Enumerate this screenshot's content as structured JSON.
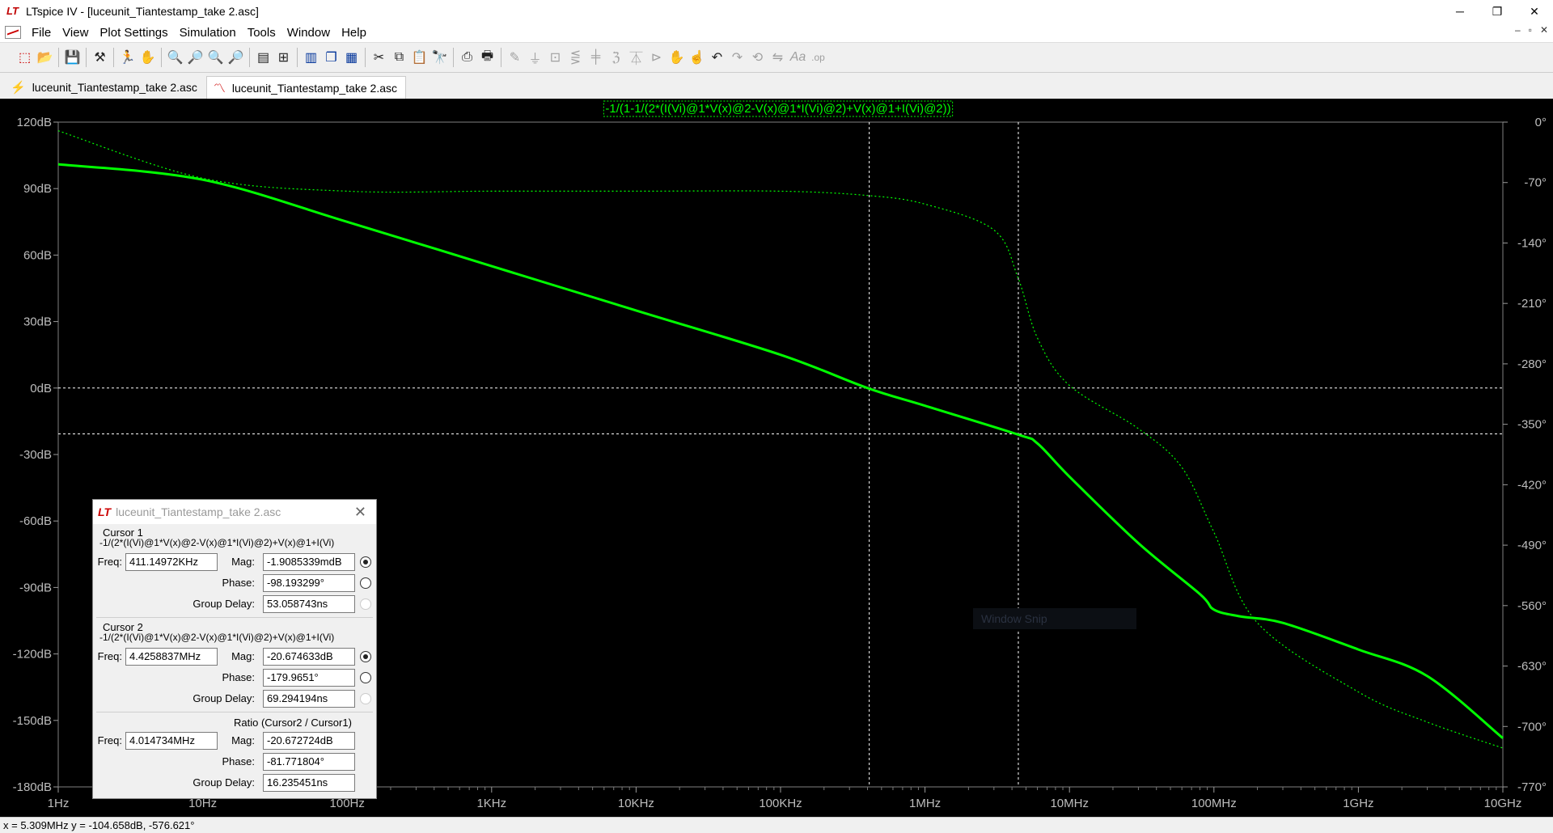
{
  "window": {
    "title": "LTspice IV - [luceunit_Tiantestamp_take 2.asc]",
    "app_icon_text": "LT",
    "controls": [
      "─",
      "❐",
      "✕"
    ]
  },
  "menu": {
    "items": [
      "File",
      "View",
      "Plot Settings",
      "Simulation",
      "Tools",
      "Window",
      "Help"
    ],
    "mdi_controls": [
      "–",
      "▫",
      "✕"
    ]
  },
  "tabs": [
    {
      "label": "luceunit_Tiantestamp_take 2.asc",
      "icon": "schematic-icon",
      "glyph": "⚡"
    },
    {
      "label": "luceunit_Tiantestamp_take 2.asc",
      "icon": "waveform-icon",
      "glyph": "〽"
    }
  ],
  "plot": {
    "trace_label": "-1/(1-1/(2*(I(Vi)@1*V(x)@2-V(x)@1*I(Vi)@2)+V(x)@1+I(Vi)@2))",
    "trace_color": "#00ff00",
    "background": "#000000",
    "left_axis_ticks": [
      "120dB",
      "90dB",
      "60dB",
      "30dB",
      "0dB",
      "-30dB",
      "-60dB",
      "-90dB",
      "-120dB",
      "-150dB",
      "-180dB"
    ],
    "right_axis_ticks": [
      "0°",
      "-70°",
      "-140°",
      "-210°",
      "-280°",
      "-350°",
      "-420°",
      "-490°",
      "-560°",
      "-630°",
      "-700°",
      "-770°"
    ],
    "x_axis_ticks": [
      "1Hz",
      "10Hz",
      "100Hz",
      "1KHz",
      "10KHz",
      "100KHz",
      "1MHz",
      "10MHz",
      "100MHz",
      "1GHz",
      "10GHz"
    ]
  },
  "chart_data": {
    "type": "line",
    "title": "-1/(1-1/(2*(I(Vi)@1*V(x)@2-V(x)@1*I(Vi)@2)+V(x)@1+I(Vi)@2))",
    "xscale": "log",
    "xlim": [
      1,
      10000000000
    ],
    "ylim_left": [
      -180,
      120
    ],
    "ylim_right": [
      -770,
      0
    ],
    "grid": false,
    "series": [
      {
        "style": "solid",
        "axis": "left",
        "x": [
          1,
          10,
          100,
          1000,
          10000,
          100000,
          400000,
          1000000,
          4400000,
          6000000,
          10000000,
          30000000,
          80000000,
          100000000,
          150000000,
          300000000,
          1000000000,
          3000000000,
          10000000000
        ],
        "y": [
          101,
          94,
          75,
          55,
          35,
          15,
          0,
          -8,
          -21,
          -25,
          -40,
          -70,
          -93,
          -100,
          -103,
          -106,
          -118,
          -130,
          -158
        ]
      },
      {
        "style": "dotted",
        "axis": "right",
        "x": [
          1,
          10,
          100,
          1000,
          10000,
          100000,
          400000,
          1000000,
          3000000,
          4400000,
          6000000,
          10000000,
          30000000,
          60000000,
          100000000,
          200000000,
          1000000000,
          3000000000,
          10000000000
        ],
        "y": [
          -10,
          -65,
          -80,
          -80,
          -80,
          -80,
          -85,
          -95,
          -125,
          -180,
          -250,
          -305,
          -355,
          -400,
          -475,
          -580,
          -660,
          -695,
          -725
        ]
      }
    ],
    "cursors": [
      {
        "x": 411149.72,
        "y": -0.0019085339
      },
      {
        "x": 4425883.7,
        "y": -20.674633
      }
    ]
  },
  "cursor_window": {
    "title": "luceunit_Tiantestamp_take 2.asc",
    "cursor1": {
      "label": "Cursor 1",
      "expr": "-1/(2*(I(Vi)@1*V(x)@2-V(x)@1*I(Vi)@2)+V(x)@1+I(Vi)",
      "freq_label": "Freq:",
      "freq": "411.14972KHz",
      "mag_label": "Mag:",
      "mag": "-1.9085339mdB",
      "phase_label": "Phase:",
      "phase": "-98.193299°",
      "gd_label": "Group Delay:",
      "gd": "53.058743ns"
    },
    "cursor2": {
      "label": "Cursor 2",
      "expr": "-1/(2*(I(Vi)@1*V(x)@2-V(x)@1*I(Vi)@2)+V(x)@1+I(Vi)",
      "freq_label": "Freq:",
      "freq": "4.4258837MHz",
      "mag_label": "Mag:",
      "mag": "-20.674633dB",
      "phase_label": "Phase:",
      "phase": "-179.9651°",
      "gd_label": "Group Delay:",
      "gd": "69.294194ns"
    },
    "ratio": {
      "label": "Ratio (Cursor2 / Cursor1)",
      "freq_label": "Freq:",
      "freq": "4.014734MHz",
      "mag_label": "Mag:",
      "mag": "-20.672724dB",
      "phase_label": "Phase:",
      "phase": "-81.771804°",
      "gd_label": "Group Delay:",
      "gd": "16.235451ns"
    }
  },
  "snip_overlay": "Window Snip",
  "status": "x = 5.309MHz    y = -104.658dB, -576.621°"
}
